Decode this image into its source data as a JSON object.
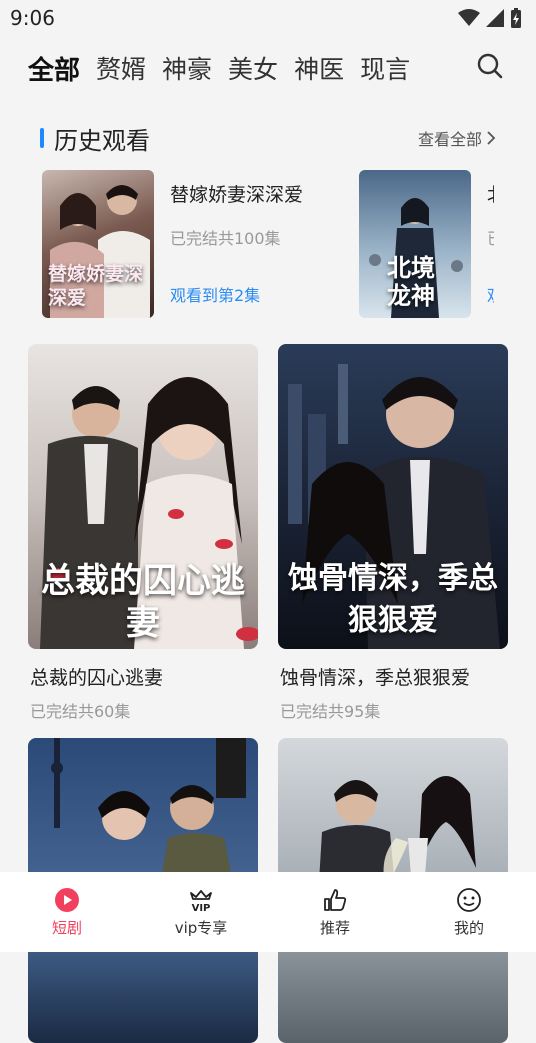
{
  "status_bar": {
    "time": "9:06"
  },
  "tabs": [
    {
      "label": "全部",
      "active": true
    },
    {
      "label": "赘婿"
    },
    {
      "label": "神豪"
    },
    {
      "label": "美女"
    },
    {
      "label": "神医"
    },
    {
      "label": "现言"
    }
  ],
  "history": {
    "title": "历史观看",
    "view_all": "查看全部",
    "items": [
      {
        "name": "替嫁娇妻深深爱",
        "status": "已完结共100集",
        "progress": "观看到第2集",
        "poster_text": "替嫁娇妻深深爱"
      },
      {
        "name": "北",
        "status": "已",
        "progress": "观",
        "poster_text": "北境龙神"
      }
    ]
  },
  "cards": [
    {
      "title": "总裁的囚心逃妻",
      "status": "已完结共60集",
      "poster_text": "总裁的囚心逃妻"
    },
    {
      "title": "蚀骨情深，季总狠狠爱",
      "status": "已完结共95集",
      "poster_text": "蚀骨情深，季总狠狠爱"
    },
    {
      "title": "",
      "status": "",
      "poster_text": ""
    },
    {
      "title": "",
      "status": "",
      "poster_text": ""
    }
  ],
  "bottom_nav": [
    {
      "label": "短剧",
      "icon": "play-circle-icon",
      "active": true
    },
    {
      "label": "vip专享",
      "icon": "vip-crown-icon"
    },
    {
      "label": "推荐",
      "icon": "thumbs-up-icon"
    },
    {
      "label": "我的",
      "icon": "smiley-face-icon"
    }
  ],
  "colors": {
    "accent_blue": "#2a8cf4",
    "active_red": "#f0405e",
    "background": "#f4f4f4"
  }
}
